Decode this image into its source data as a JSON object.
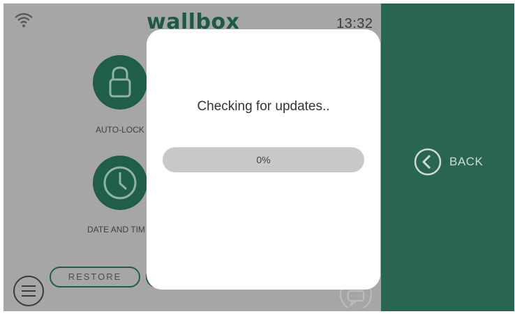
{
  "header": {
    "logo_text": "wallbox",
    "time": "13:32",
    "wifi_icon": "wifi-icon"
  },
  "menu": {
    "items": [
      {
        "label": "AUTO-LOCK",
        "icon": "lock-icon"
      },
      {
        "label": "DATE AND TIM",
        "icon": "clock-icon"
      }
    ],
    "restore_label": "RESTORE",
    "menu_icon": "hamburger-icon",
    "chat_icon": "chat-icon"
  },
  "side_panel": {
    "back_label": "BACK",
    "back_icon": "chevron-left-circle-icon"
  },
  "dialog": {
    "title": "Checking for updates..",
    "progress_text": "0%",
    "progress_value": 0
  },
  "colors": {
    "brand_green": "#2a6553",
    "dark_green": "#1f5e47",
    "overlay_gray": "#a6a6a6",
    "modal_bg": "#ffffff"
  }
}
